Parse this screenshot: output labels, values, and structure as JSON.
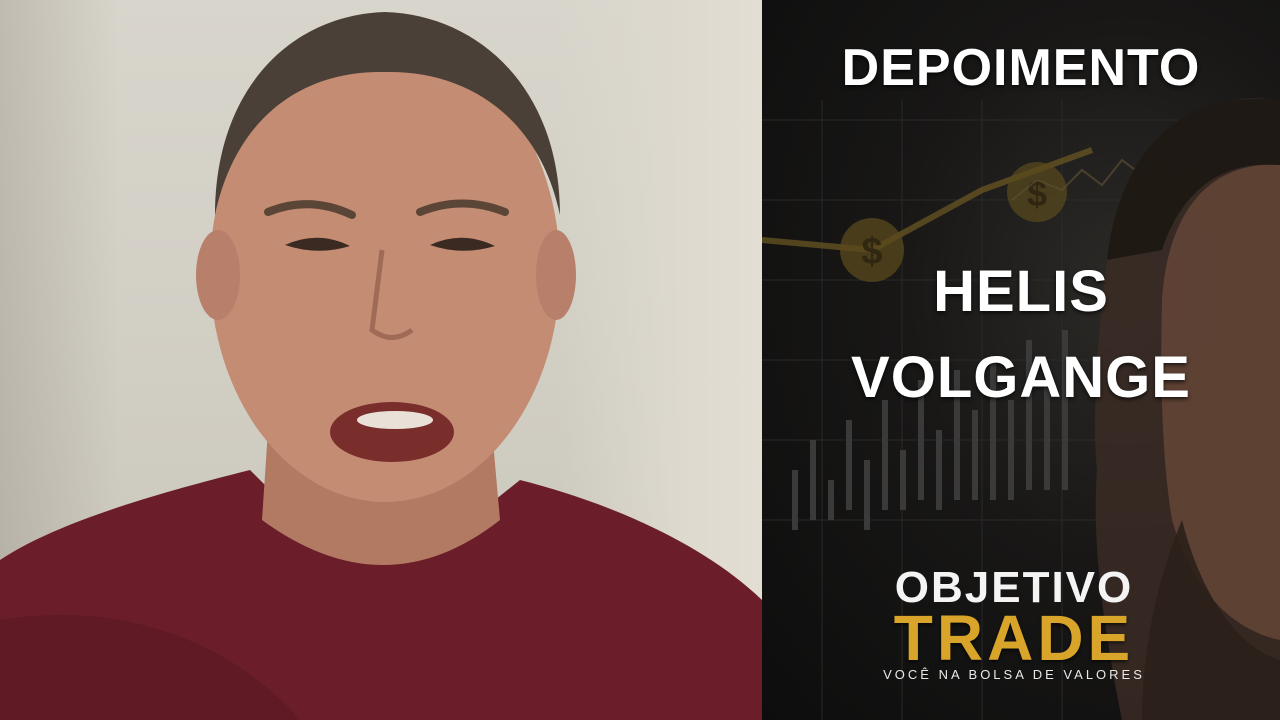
{
  "promo": {
    "title": "DEPOIMENTO",
    "name_line1": "HELIS",
    "name_line2": "VOLGANGE"
  },
  "logo": {
    "line1": "OBJETIVO",
    "line2": "TRADE",
    "tagline": "VOCÊ NA BOLSA DE VALORES"
  },
  "colors": {
    "brand_gold": "#d8a52a",
    "shirt": "#6b1e2a",
    "wall": "#d4d1c7",
    "text": "#ffffff"
  }
}
